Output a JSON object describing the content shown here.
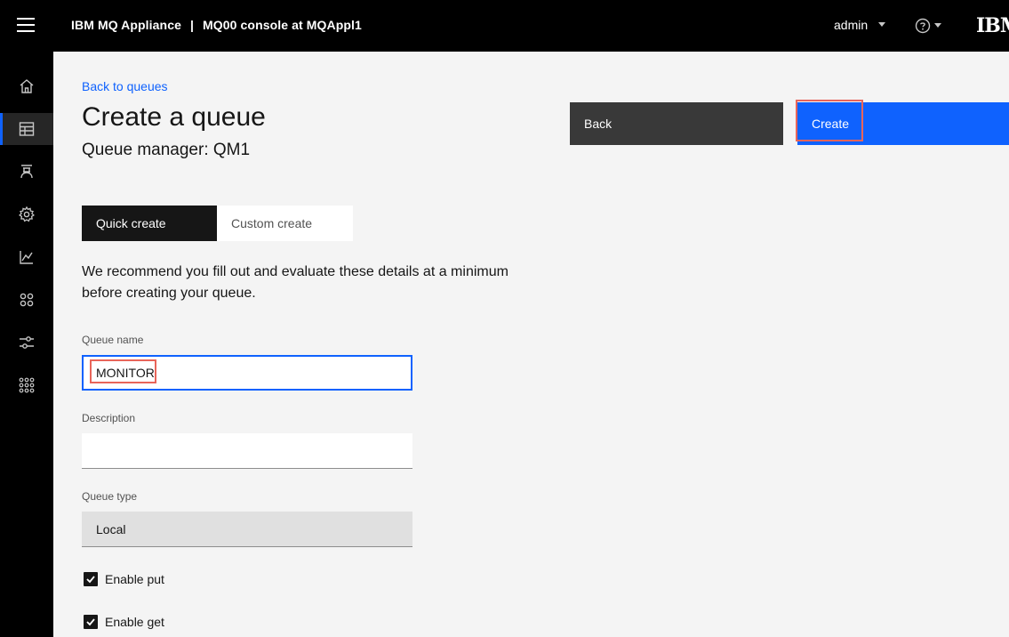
{
  "header": {
    "product": "IBM MQ Appliance",
    "separator": "|",
    "console": "MQ00 console at MQAppl1",
    "user": "admin",
    "logo": "IBM",
    "icons": [
      "menu-icon",
      "help-icon",
      "chevron-down-icon"
    ]
  },
  "sidenav": {
    "items": [
      {
        "name": "home",
        "icon": "home-icon",
        "active": false
      },
      {
        "name": "local-queue-managers",
        "icon": "table-icon",
        "active": true
      },
      {
        "name": "queue-managers-remote",
        "icon": "broker-icon",
        "active": false
      },
      {
        "name": "settings",
        "icon": "gear-icon",
        "active": false
      },
      {
        "name": "statistics",
        "icon": "chart-line-icon",
        "active": false
      },
      {
        "name": "applications",
        "icon": "apps-icon",
        "active": false
      },
      {
        "name": "configuration",
        "icon": "sliders-icon",
        "active": false
      },
      {
        "name": "network",
        "icon": "grid-dots-icon",
        "active": false
      }
    ]
  },
  "main": {
    "back_link": "Back to queues",
    "title": "Create a queue",
    "queue_manager": "Queue manager: QM1",
    "back_button": "Back",
    "create_button": "Create",
    "tabs": [
      {
        "label": "Quick create",
        "selected": true
      },
      {
        "label": "Custom create",
        "selected": false
      }
    ],
    "intro": "We recommend you fill out and evaluate these details at a minimum before creating your queue.",
    "fields": {
      "queue_name_label": "Queue name",
      "queue_name_value": "MONITOR",
      "description_label": "Description",
      "description_value": "",
      "queue_type_label": "Queue type",
      "queue_type_value": "Local"
    },
    "checkboxes": [
      {
        "label": "Enable put",
        "checked": true
      },
      {
        "label": "Enable get",
        "checked": true
      }
    ]
  },
  "colors": {
    "accent": "#0f62fe",
    "highlight": "#e8655a",
    "header_bg": "#000000"
  }
}
